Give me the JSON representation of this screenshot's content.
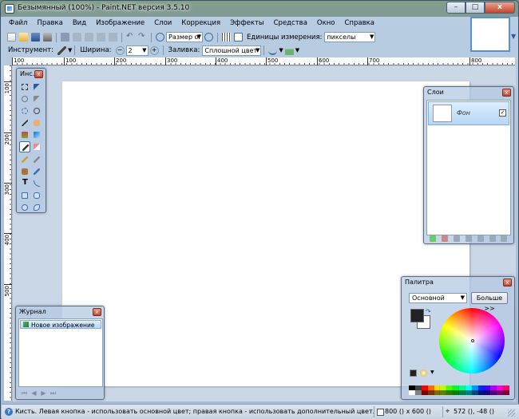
{
  "window": {
    "title": "Безымянный (100%) - Paint.NET версия 3.5.10",
    "min_label": "–",
    "max_label": "□",
    "close_label": "x"
  },
  "menu": [
    "Файл",
    "Правка",
    "Вид",
    "Изображение",
    "Слои",
    "Коррекция",
    "Эффекты",
    "Средства",
    "Окно",
    "Справка"
  ],
  "toolbar": {
    "zoom_combo": "Размер оі",
    "units_label": "Единицы измерения:",
    "units_value": "пикселы",
    "tool_label": "Инструмент:",
    "width_label": "Ширина:",
    "width_value": "2",
    "fill_label": "Заливка:",
    "fill_value": "Сплошной цвет"
  },
  "ruler": {
    "h_numbers": [
      "100",
      "100",
      "200",
      "300",
      "400",
      "500",
      "600",
      "700",
      "800"
    ],
    "v_numbers": [
      "100",
      "200",
      "300",
      "400",
      "500"
    ]
  },
  "tools_window": {
    "title": "Инс..."
  },
  "layers_window": {
    "title": "Слои",
    "layer_name": "Фон",
    "checked": "✓"
  },
  "history_window": {
    "title": "Журнал",
    "item": "Новое изображение"
  },
  "palette_window": {
    "title": "Палитра",
    "mode": "Основной",
    "more_button": "Больше >>",
    "primary_color": "#222222",
    "secondary_color": "#ffffff",
    "swatches_top": [
      "#000000",
      "#404040",
      "#ff0000",
      "#ff6a00",
      "#ffd800",
      "#b6ff00",
      "#4cff00",
      "#00ff21",
      "#00ff90",
      "#00ffff",
      "#0094ff",
      "#0026ff",
      "#4800ff",
      "#b200ff",
      "#ff00dc",
      "#ff006e"
    ],
    "swatches_bottom": [
      "#ffffff",
      "#808080",
      "#7f0000",
      "#7f3300",
      "#7f6a00",
      "#5b7f00",
      "#267f00",
      "#007f0e",
      "#007f46",
      "#007f7f",
      "#004a7f",
      "#00137f",
      "#21007f",
      "#57007f",
      "#7f006e",
      "#7f0037"
    ]
  },
  "status": {
    "help": "?",
    "text": "Кисть. Левая кнопка - использовать основной цвет; правая кнопка - использовать дополнительный цвет.",
    "image_size": "800 () x 600 ()",
    "cursor_pos": "572 (), -48 ()"
  },
  "colors": {
    "accent": "#3a6fb0",
    "workspace": "#cad7e6"
  }
}
